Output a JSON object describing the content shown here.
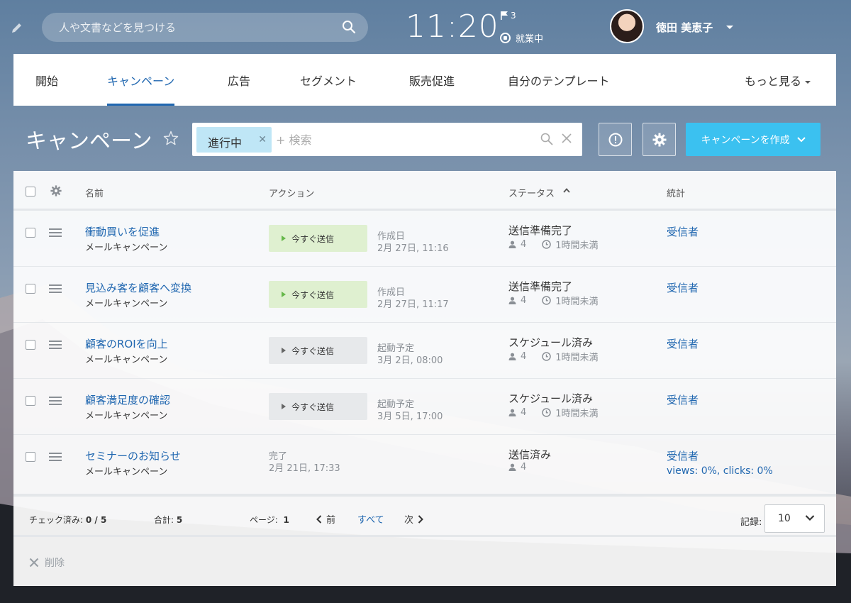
{
  "topbar": {
    "search_placeholder": "人や文書などを見つける",
    "clock": "11:20",
    "flag_count": "3",
    "work_status": "就業中",
    "user_name": "徳田 美恵子"
  },
  "nav": {
    "items": [
      "開始",
      "キャンペーン",
      "広告",
      "セグメント",
      "販売促進",
      "自分のテンプレート"
    ],
    "active": "キャンペーン",
    "more": "もっと見る"
  },
  "toolbar": {
    "title": "キャンペーン",
    "filter_chip": "進行中",
    "filter_placeholder": "+ 検索",
    "create_button": "キャンペーンを作成"
  },
  "table": {
    "headers": {
      "name": "名前",
      "action": "アクション",
      "status": "ステータス",
      "stats": "統計"
    },
    "rows": [
      {
        "name": "衝動買いを促進",
        "type": "メールキャンペーン",
        "action": "今すぐ送信",
        "action_style": "green",
        "date_label": "作成日",
        "date": "2月 27日, 11:16",
        "status": "送信準備完了",
        "recipients": "4",
        "time": "1時間未満",
        "stat": "受信者",
        "stat_sub": ""
      },
      {
        "name": "見込み客を顧客へ変換",
        "type": "メールキャンペーン",
        "action": "今すぐ送信",
        "action_style": "green",
        "date_label": "作成日",
        "date": "2月 27日, 11:17",
        "status": "送信準備完了",
        "recipients": "4",
        "time": "1時間未満",
        "stat": "受信者",
        "stat_sub": ""
      },
      {
        "name": "顧客のROIを向上",
        "type": "メールキャンペーン",
        "action": "今すぐ送信",
        "action_style": "grey",
        "date_label": "起動予定",
        "date": "3月 2日, 08:00",
        "status": "スケジュール済み",
        "recipients": "4",
        "time": "1時間未満",
        "stat": "受信者",
        "stat_sub": ""
      },
      {
        "name": "顧客満足度の確認",
        "type": "メールキャンペーン",
        "action": "今すぐ送信",
        "action_style": "grey",
        "date_label": "起動予定",
        "date": "3月 5日, 17:00",
        "status": "スケジュール済み",
        "recipients": "4",
        "time": "1時間未満",
        "stat": "受信者",
        "stat_sub": ""
      },
      {
        "name": "セミナーのお知らせ",
        "type": "メールキャンペーン",
        "action": "",
        "action_style": "none",
        "date_label": "完了",
        "date": "2月 21日, 17:33",
        "status": "送信済み",
        "recipients": "4",
        "time": "",
        "stat": "受信者",
        "stat_sub": "views: 0%, clicks: 0%"
      }
    ]
  },
  "footer": {
    "checked_label": "チェック済み:",
    "checked_value": "0 / 5",
    "total_label": "合計:",
    "total_value": "5",
    "page_label": "ページ:",
    "page_value": "1",
    "prev": "前",
    "all": "すべて",
    "next": "次",
    "records_label": "記録:",
    "records_value": "10",
    "delete": "削除"
  },
  "colors": {
    "accent": "#2067b0",
    "create_button": "#3bc1f0",
    "send_ready": "#dff0d0",
    "send_scheduled": "#e7e9eb"
  }
}
